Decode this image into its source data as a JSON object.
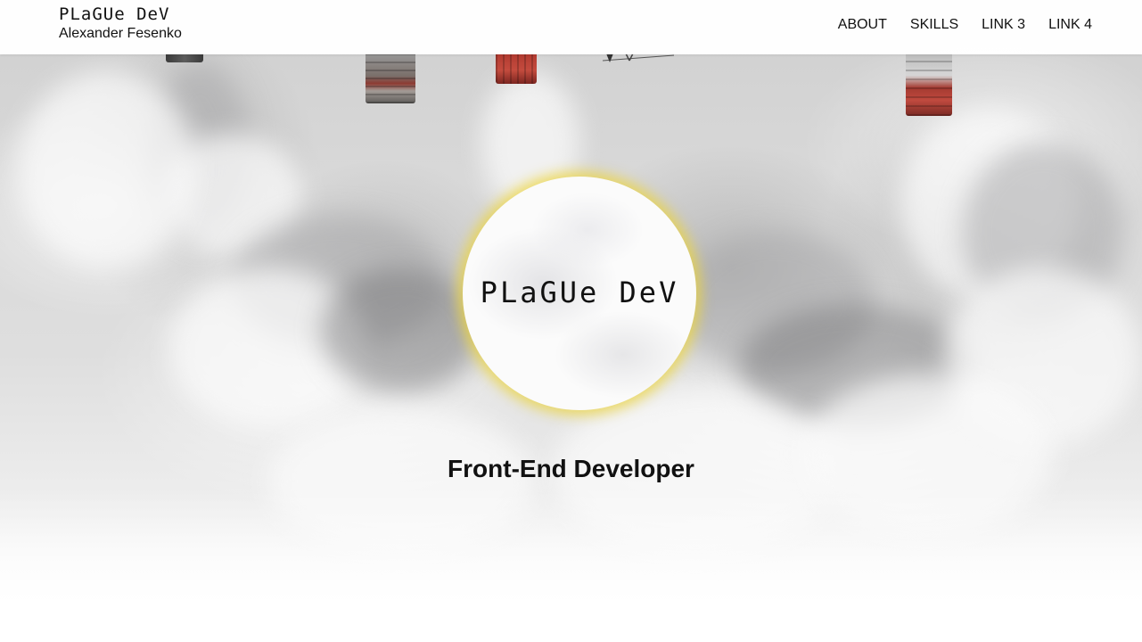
{
  "header": {
    "logo_text": "PLaGUe DeV",
    "owner_name": "Alexander Fesenko",
    "nav": [
      {
        "label": "ABOUT"
      },
      {
        "label": "SKILLS"
      },
      {
        "label": "LINK 3"
      },
      {
        "label": "LINK 4"
      }
    ]
  },
  "hero": {
    "circle_logo_text": "PLaGUe DeV",
    "role_title": "Front-End Developer",
    "accent_color": "#ecd43c",
    "background_image": "smoke-from-chimneys"
  }
}
